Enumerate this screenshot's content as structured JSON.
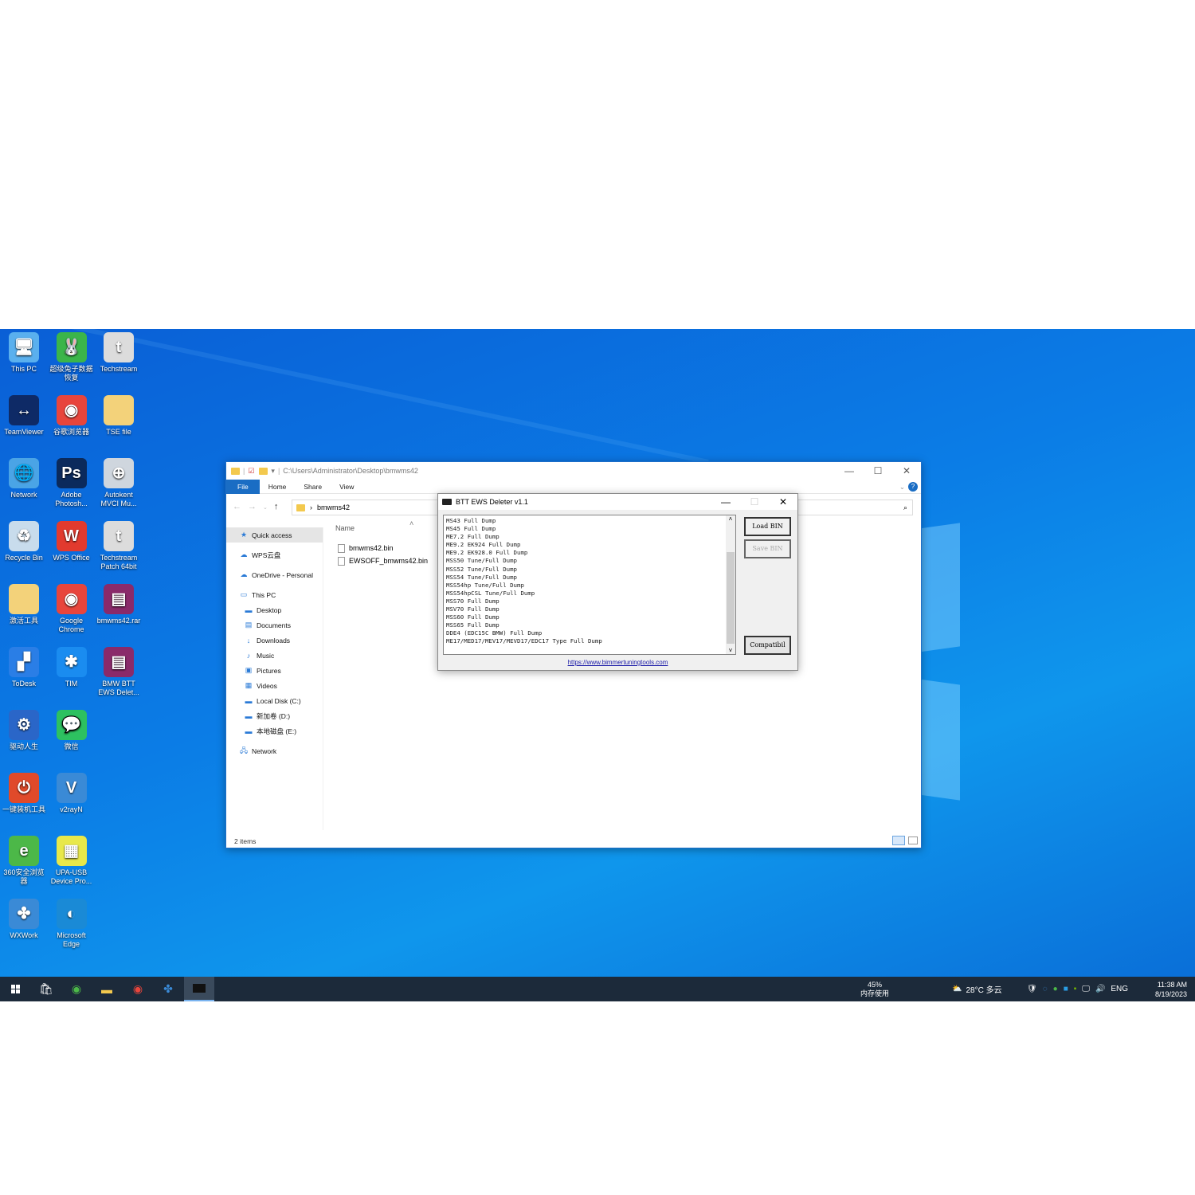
{
  "desktop": {
    "icons": [
      {
        "label": "This PC",
        "color": "#5ab0ee",
        "glyph": "🖥",
        "name": "this-pc"
      },
      {
        "label": "超级兔子数据恢复",
        "color": "#3bb54a",
        "glyph": "🐰",
        "name": "rabbit-recovery"
      },
      {
        "label": "Techstream",
        "color": "#dcdcdc",
        "glyph": "t",
        "name": "techstream"
      },
      {
        "label": "TeamViewer",
        "color": "#0e2a66",
        "glyph": "↔",
        "name": "teamviewer"
      },
      {
        "label": "谷歌浏览器",
        "color": "#e8453c",
        "glyph": "◉",
        "name": "google-chrome-cn"
      },
      {
        "label": "TSE file",
        "color": "#f3d27a",
        "glyph": "",
        "name": "tse-file"
      },
      {
        "label": "Network",
        "color": "#4aa4e6",
        "glyph": "🌐",
        "name": "network"
      },
      {
        "label": "Adobe Photosh...",
        "color": "#0b2a5c",
        "glyph": "Ps",
        "name": "adobe-photoshop"
      },
      {
        "label": "Autokent MVCI Mu...",
        "color": "#cfd6de",
        "glyph": "⊕",
        "name": "autokent-mvci"
      },
      {
        "label": "Recycle Bin",
        "color": "#c8dcec",
        "glyph": "♻",
        "name": "recycle-bin"
      },
      {
        "label": "WPS Office",
        "color": "#e23a2e",
        "glyph": "W",
        "name": "wps-office"
      },
      {
        "label": "Techstream Patch 64bit",
        "color": "#dcdcdc",
        "glyph": "t",
        "name": "techstream-patch"
      },
      {
        "label": "激活工具",
        "color": "#f3d27a",
        "glyph": "",
        "name": "activation-tool"
      },
      {
        "label": "Google Chrome",
        "color": "#e8453c",
        "glyph": "◉",
        "name": "google-chrome"
      },
      {
        "label": "bmwms42.rar",
        "color": "#8a2a6a",
        "glyph": "▤",
        "name": "bmwms42-rar"
      },
      {
        "label": "ToDesk",
        "color": "#2a7ee6",
        "glyph": "▞",
        "name": "todesk"
      },
      {
        "label": "TIM",
        "color": "#1a8cf0",
        "glyph": "✱",
        "name": "tim"
      },
      {
        "label": "BMW BTT EWS Delet...",
        "color": "#8a2a6a",
        "glyph": "▤",
        "name": "bmw-btt-ews-deleter"
      },
      {
        "label": "驱动人生",
        "color": "#2a66c8",
        "glyph": "⚙",
        "name": "driver-life"
      },
      {
        "label": "微信",
        "color": "#2dc160",
        "glyph": "💬",
        "name": "wechat"
      },
      {
        "label": "",
        "color": "",
        "glyph": "",
        "name": ""
      },
      {
        "label": "一键装机工具",
        "color": "#e04a2a",
        "glyph": "⏻",
        "name": "one-click-install"
      },
      {
        "label": "v2rayN",
        "color": "#3a8ad6",
        "glyph": "V",
        "name": "v2rayn"
      },
      {
        "label": "",
        "color": "",
        "glyph": "",
        "name": ""
      },
      {
        "label": "360安全浏览器",
        "color": "#4cb848",
        "glyph": "e",
        "name": "360-browser"
      },
      {
        "label": "UPA-USB Device Pro...",
        "color": "#e8e84a",
        "glyph": "▦",
        "name": "upa-usb"
      },
      {
        "label": "",
        "color": "",
        "glyph": "",
        "name": ""
      },
      {
        "label": "WXWork",
        "color": "#3a8ad6",
        "glyph": "✤",
        "name": "wxwork"
      },
      {
        "label": "Microsoft Edge",
        "color": "#1a8ad6",
        "glyph": "◐",
        "name": "microsoft-edge"
      }
    ]
  },
  "explorer": {
    "path": "C:\\Users\\Administrator\\Desktop\\bmwms42",
    "tabs": [
      "File",
      "Home",
      "Share",
      "View"
    ],
    "breadcrumb": "bmwms42",
    "nav": [
      {
        "label": "Quick access",
        "icon": "★",
        "indent": 1,
        "selected": true
      },
      {
        "label": "WPS云盘",
        "icon": "☁",
        "indent": 1
      },
      {
        "label": "OneDrive - Personal",
        "icon": "☁",
        "indent": 1
      },
      {
        "label": "This PC",
        "icon": "▭",
        "indent": 1
      },
      {
        "label": "Desktop",
        "icon": "▬",
        "indent": 2
      },
      {
        "label": "Documents",
        "icon": "▤",
        "indent": 2
      },
      {
        "label": "Downloads",
        "icon": "↓",
        "indent": 2
      },
      {
        "label": "Music",
        "icon": "♪",
        "indent": 2
      },
      {
        "label": "Pictures",
        "icon": "▣",
        "indent": 2
      },
      {
        "label": "Videos",
        "icon": "▦",
        "indent": 2
      },
      {
        "label": "Local Disk (C:)",
        "icon": "▬",
        "indent": 2
      },
      {
        "label": "新加卷 (D:)",
        "icon": "▬",
        "indent": 2
      },
      {
        "label": "本地磁盘 (E:)",
        "icon": "▬",
        "indent": 2
      },
      {
        "label": "Network",
        "icon": "🖧",
        "indent": 1
      }
    ],
    "column": "Name",
    "files": [
      "bmwms42.bin",
      "EWSOFF_bmwms42.bin"
    ],
    "status": "2 items"
  },
  "btt": {
    "title": "BTT EWS Deleter v1.1",
    "list": [
      "MS43 Full Dump",
      "MS45 Full Dump",
      "ME7.2 Full Dump",
      "ME9.2 EK924 Full Dump",
      "ME9.2 EK928.0 Full Dump",
      "MSS50 Tune/Full Dump",
      "MSS52 Tune/Full Dump",
      "MSS54 Tune/Full Dump",
      "MSS54hp Tune/Full Dump",
      "MSS54hpCSL Tune/Full Dump",
      "MSS70 Full Dump",
      "MSV70 Full Dump",
      "MSS60 Full Dump",
      "MSS65 Full Dump",
      "DDE4 (EDC15C BMW) Full Dump",
      "ME17/MED17/MEV17/MEVD17/EDC17 Type Full Dump"
    ],
    "load": "Load BIN",
    "save": "Save BIN",
    "compat": "Compatibil",
    "link": "https://www.bimmertuningtools.com"
  },
  "taskbar": {
    "mem_pct": "45%",
    "mem_label": "内存使用",
    "weather": "28°C 多云",
    "lang": "ENG",
    "time": "11:38 AM",
    "date": "8/19/2023"
  }
}
